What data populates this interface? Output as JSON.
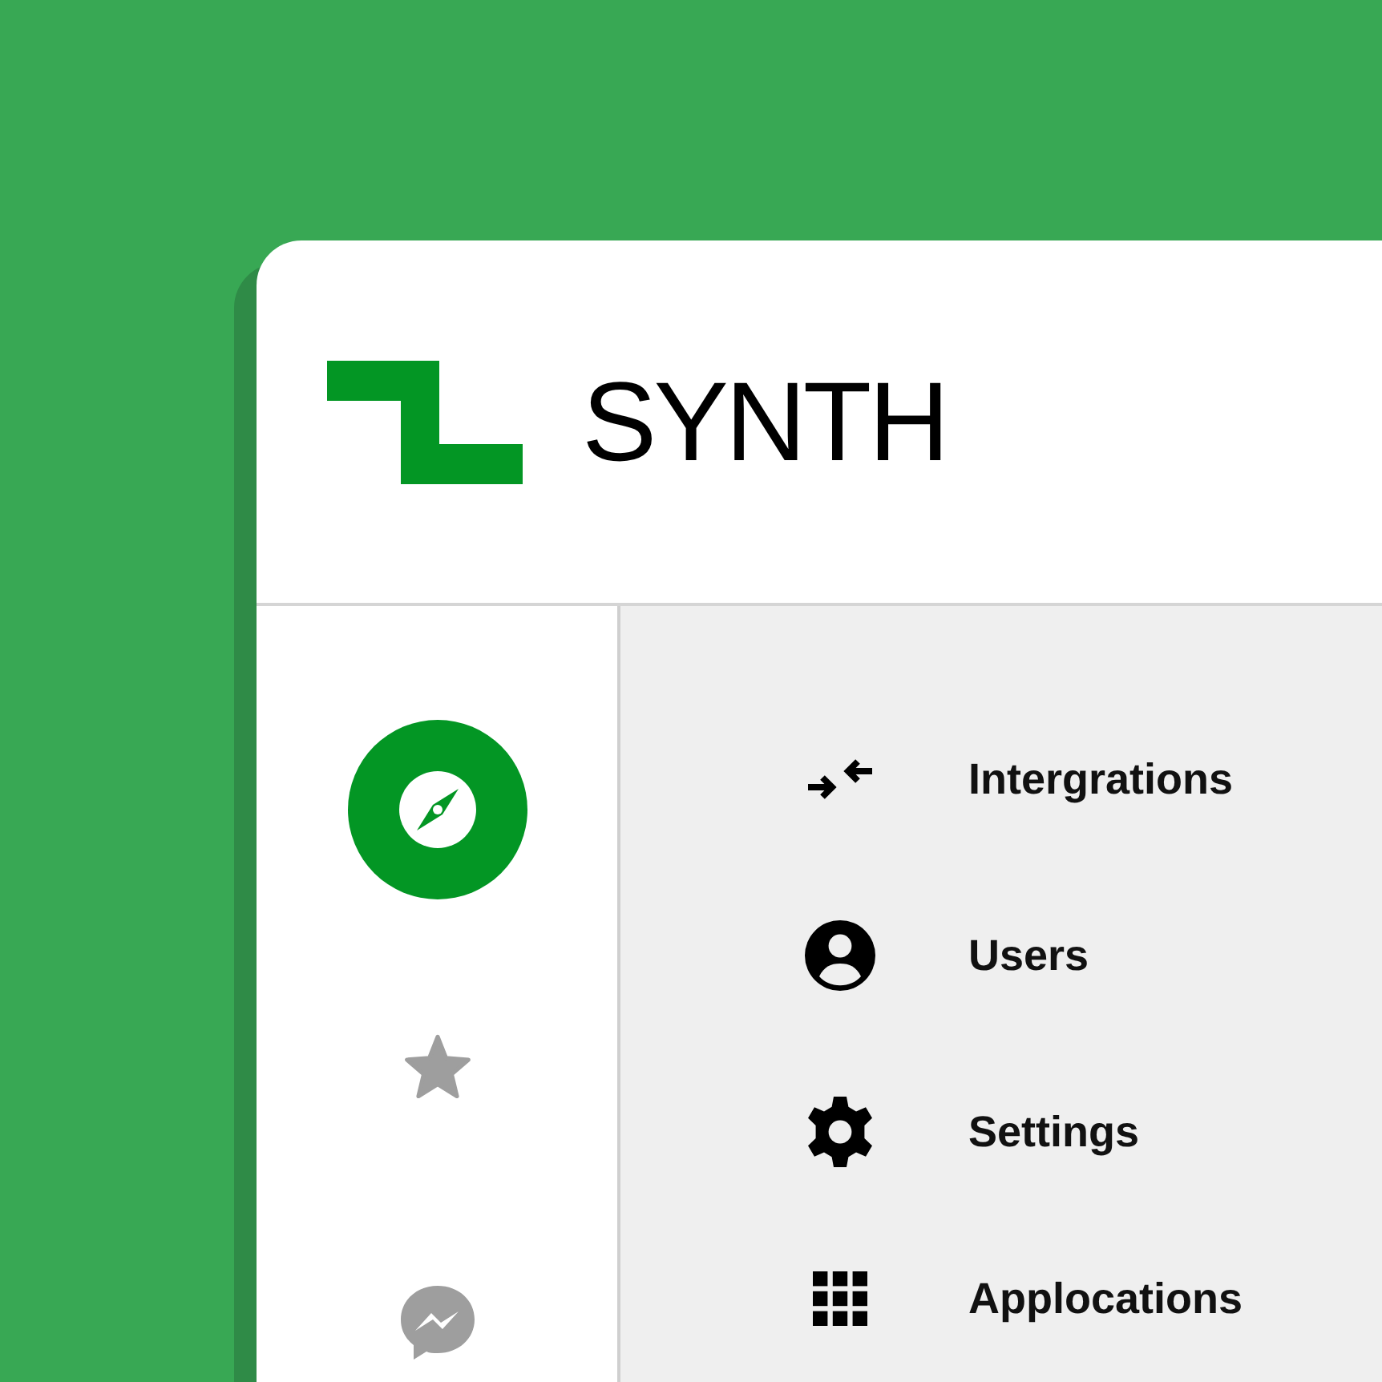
{
  "brand": {
    "name": "SYNTH"
  },
  "sidebar": {
    "items": [
      {
        "kind": "compass",
        "selected": true
      },
      {
        "kind": "star",
        "selected": false
      },
      {
        "kind": "messenger",
        "selected": false
      }
    ]
  },
  "menu_groups": [
    {
      "items": [
        {
          "kind": "arrows",
          "label": "Intergrations"
        },
        {
          "kind": "user",
          "label": "Users"
        },
        {
          "kind": "gear",
          "label": "Settings"
        }
      ]
    },
    {
      "items": [
        {
          "kind": "grid",
          "label": "Applocations"
        }
      ]
    }
  ]
}
